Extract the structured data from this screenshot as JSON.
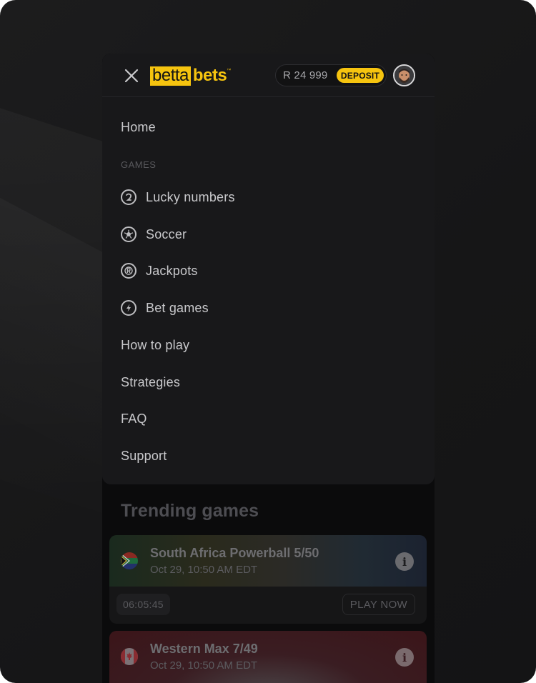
{
  "header": {
    "logo_part1": "betta",
    "logo_part2": "bets",
    "logo_tm": "™",
    "balance": "R 24 999",
    "deposit_label": "DEPOSIT"
  },
  "menu": {
    "home": "Home",
    "section_games": "GAMES",
    "games": [
      {
        "label": "Lucky numbers",
        "icon": "lucky-numbers-icon"
      },
      {
        "label": "Soccer",
        "icon": "soccer-ball-icon"
      },
      {
        "label": "Jackpots",
        "icon": "jackpot-coin-icon"
      },
      {
        "label": "Bet games",
        "icon": "lightning-icon"
      }
    ],
    "links": [
      "How to play",
      "Strategies",
      "FAQ",
      "Support"
    ]
  },
  "trending": {
    "title": "Trending games",
    "cards": [
      {
        "title": "South Africa Powerball 5/50",
        "subtitle": "Oct 29, 10:50 AM EDT",
        "flag": "south-africa-flag-icon",
        "timer": "06:05:45",
        "action": "PLAY NOW"
      },
      {
        "title": "Western Max 7/49",
        "subtitle": "Oct 29, 10:50 AM EDT",
        "flag": "canada-flag-icon"
      }
    ]
  },
  "colors": {
    "accent": "#f6c40f",
    "menu_bg": "#18181a",
    "page_bg": "#0b0b0c",
    "text": "#c9c9cc"
  }
}
